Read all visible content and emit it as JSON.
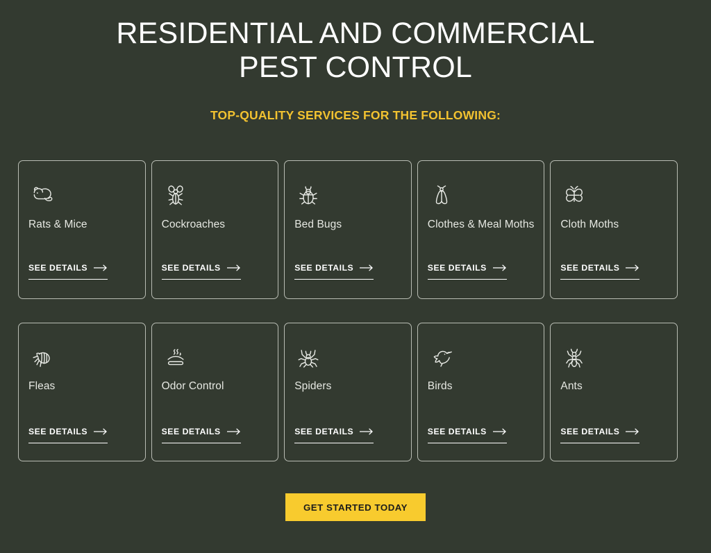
{
  "page": {
    "background_color": "#333a30",
    "accent_color": "#f2c230",
    "button_color": "#f8cb2e",
    "text_color": "#ffffff"
  },
  "header": {
    "headline_line1": "RESIDENTIAL AND COMMERCIAL",
    "headline_line2": "PEST CONTROL",
    "subheadline": "TOP-QUALITY SERVICES FOR THE FOLLOWING:"
  },
  "cards": [
    {
      "title": "Rats & Mice",
      "icon": "rat-mouse-icon",
      "link_label": "SEE DETAILS"
    },
    {
      "title": "Cockroaches",
      "icon": "cockroach-icon",
      "link_label": "SEE DETAILS"
    },
    {
      "title": "Bed Bugs",
      "icon": "bed-bug-icon",
      "link_label": "SEE DETAILS"
    },
    {
      "title": "Clothes & Meal Moths",
      "icon": "moth-icon",
      "link_label": "SEE DETAILS"
    },
    {
      "title": "Cloth Moths",
      "icon": "butterfly-moth-icon",
      "link_label": "SEE DETAILS"
    },
    {
      "title": "Fleas",
      "icon": "flea-icon",
      "link_label": "SEE DETAILS"
    },
    {
      "title": "Odor Control",
      "icon": "odor-steam-icon",
      "link_label": "SEE DETAILS"
    },
    {
      "title": "Spiders",
      "icon": "spider-icon",
      "link_label": "SEE DETAILS"
    },
    {
      "title": "Birds",
      "icon": "bird-icon",
      "link_label": "SEE DETAILS"
    },
    {
      "title": "Ants",
      "icon": "ant-icon",
      "link_label": "SEE DETAILS"
    }
  ],
  "cta": {
    "label": "GET STARTED TODAY"
  }
}
